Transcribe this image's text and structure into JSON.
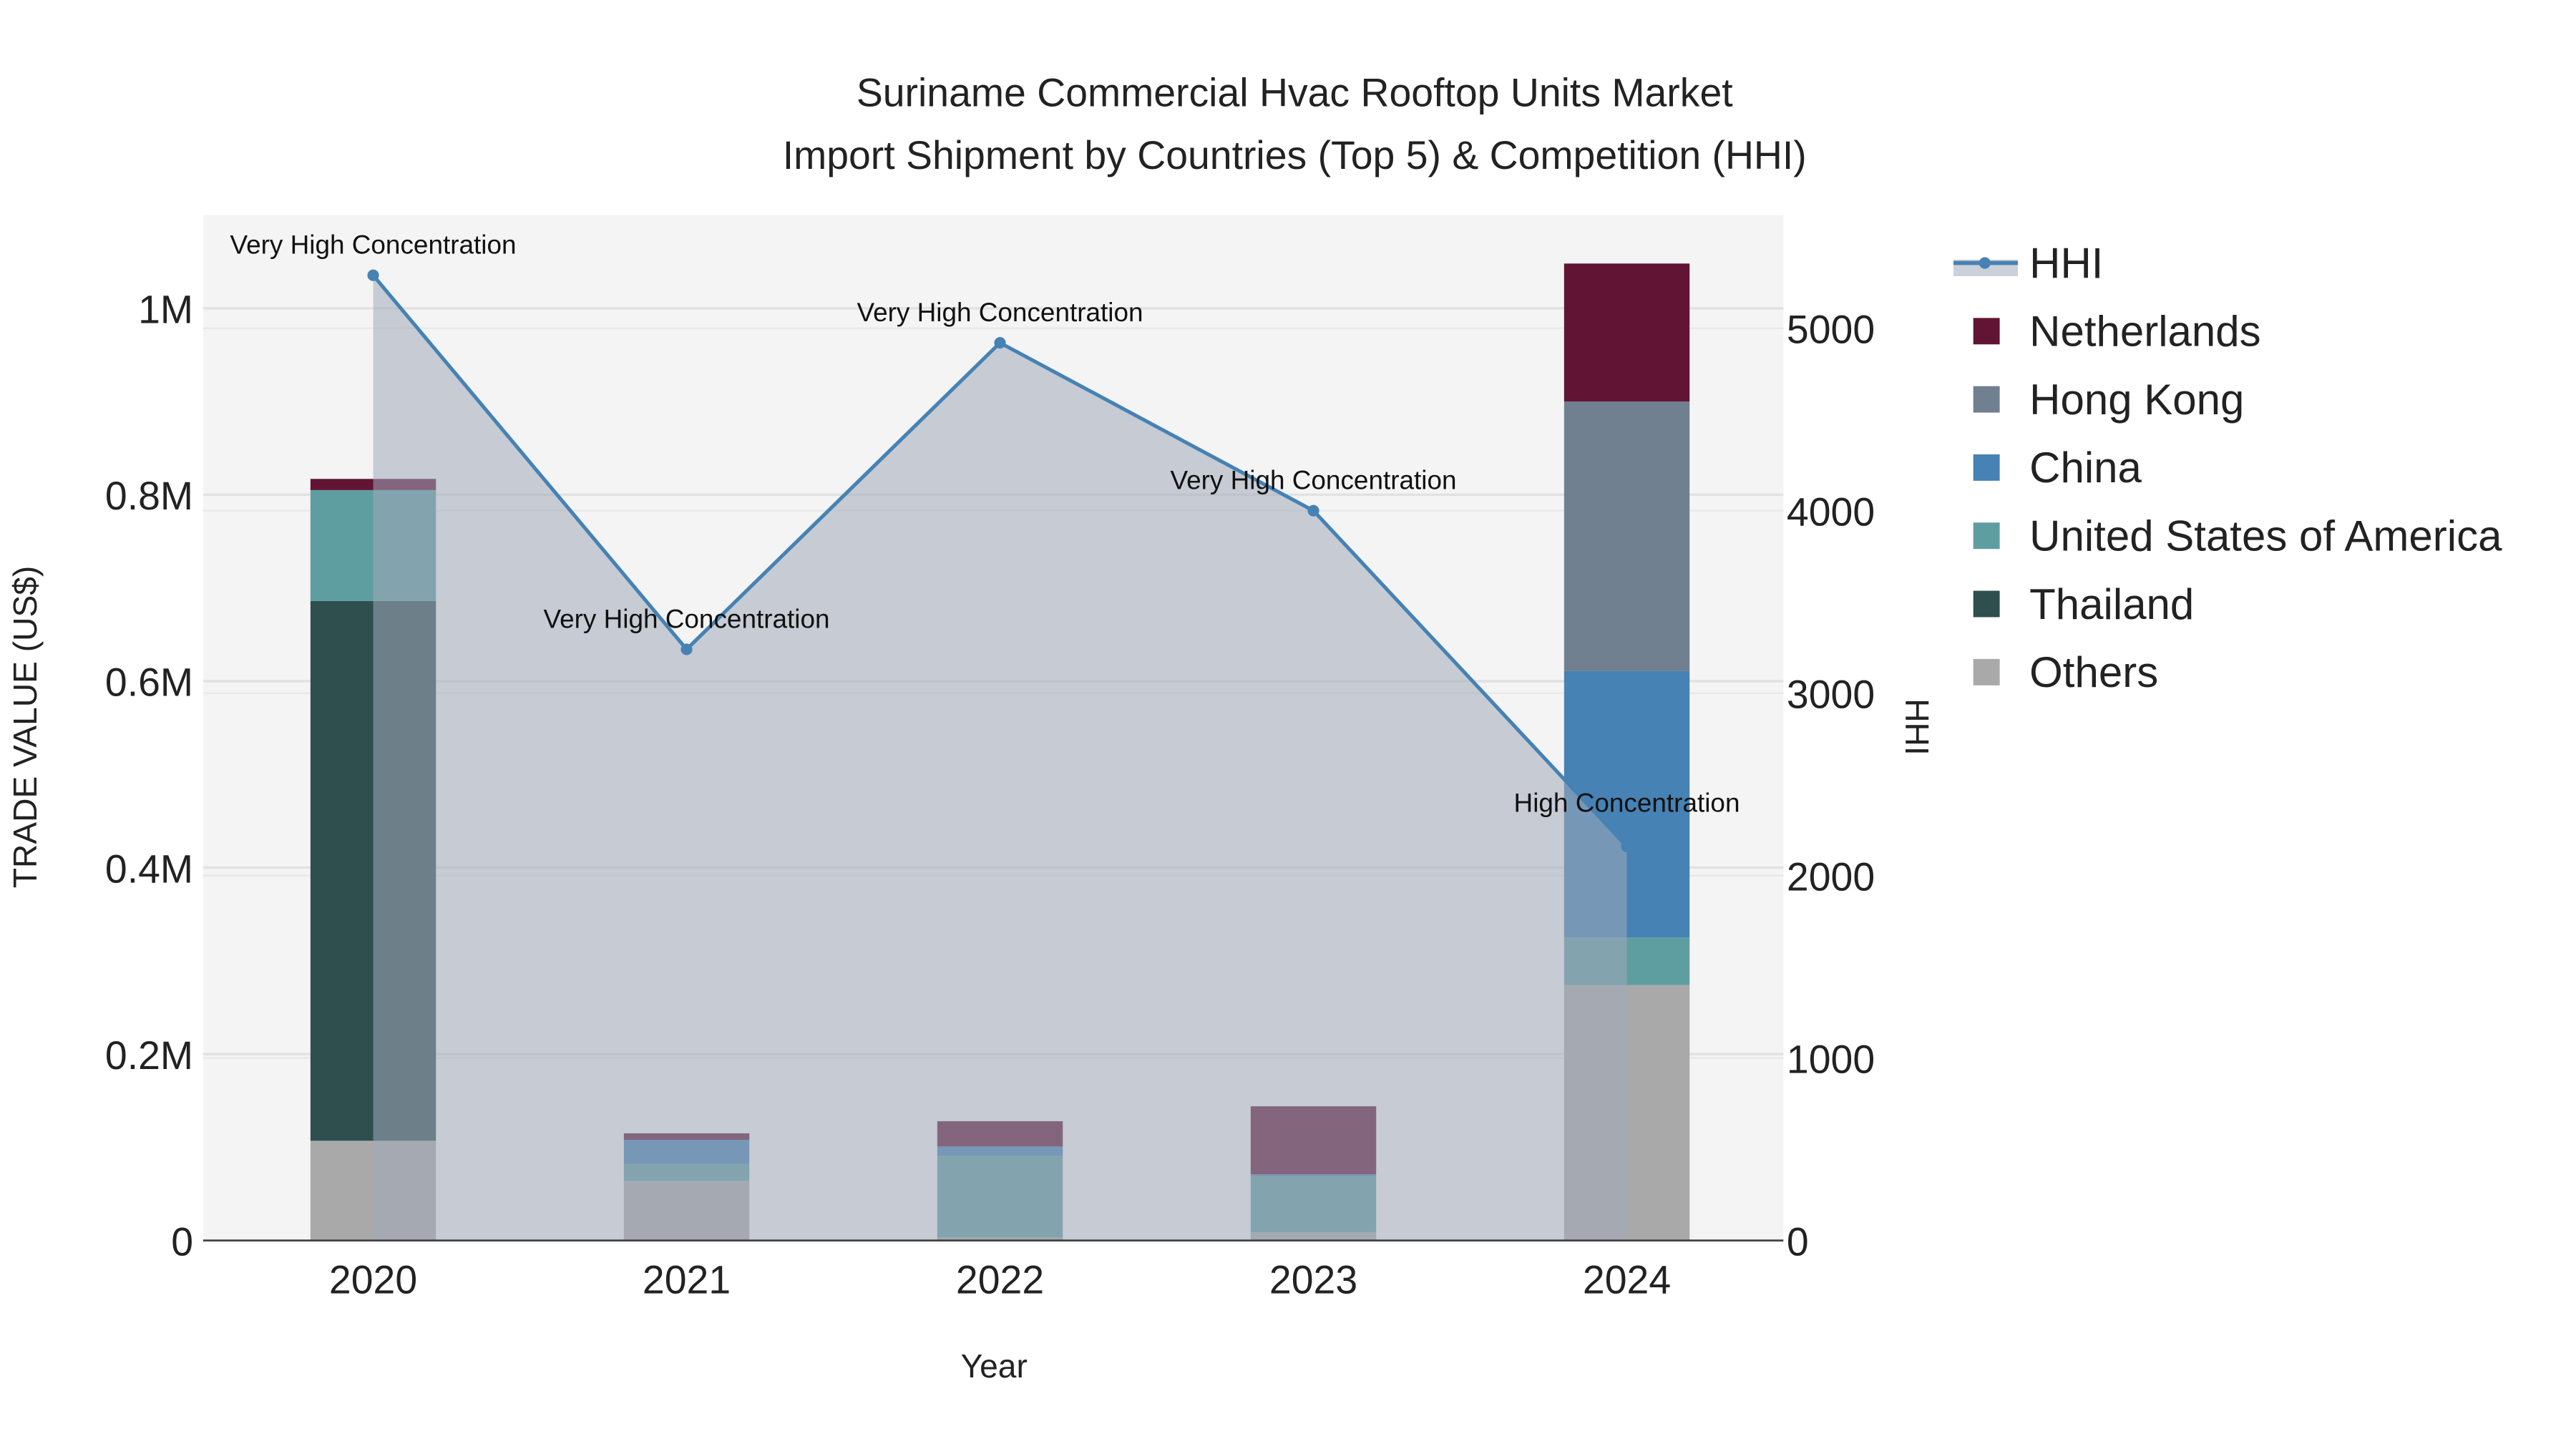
{
  "chart_data": {
    "type": "bar",
    "title": "Suriname Commercial Hvac Rooftop Units Market",
    "subtitle": "Import Shipment by Countries (Top 5) & Competition (HHI)",
    "xlabel": "Year",
    "ylabel": "TRADE VALUE (US$)",
    "y2label": "HHI",
    "categories": [
      "2020",
      "2021",
      "2022",
      "2023",
      "2024"
    ],
    "ylim": [
      0,
      1100000
    ],
    "y2lim": [
      0,
      5620
    ],
    "yticks": [
      {
        "v": 0,
        "label": "0"
      },
      {
        "v": 200000,
        "label": "0.2M"
      },
      {
        "v": 400000,
        "label": "0.4M"
      },
      {
        "v": 600000,
        "label": "0.6M"
      },
      {
        "v": 800000,
        "label": "0.8M"
      },
      {
        "v": 1000000,
        "label": "1M"
      }
    ],
    "y2ticks": [
      {
        "v": 0,
        "label": "0"
      },
      {
        "v": 1000,
        "label": "1000"
      },
      {
        "v": 2000,
        "label": "2000"
      },
      {
        "v": 3000,
        "label": "3000"
      },
      {
        "v": 4000,
        "label": "4000"
      },
      {
        "v": 5000,
        "label": "5000"
      }
    ],
    "grid": true,
    "legend_placement": "right",
    "series": [
      {
        "name": "Others",
        "color": "#a9a9a9",
        "values": [
          107000,
          64000,
          3000,
          9000,
          274000
        ]
      },
      {
        "name": "Thailand",
        "color": "#2f4f4f",
        "values": [
          579000,
          0,
          0,
          0,
          0
        ]
      },
      {
        "name": "United States of America",
        "color": "#5f9ea0",
        "values": [
          119000,
          18000,
          88000,
          60000,
          51000
        ]
      },
      {
        "name": "China",
        "color": "#4682b4",
        "values": [
          0,
          26000,
          10000,
          2000,
          286000
        ]
      },
      {
        "name": "Hong Kong",
        "color": "#708090",
        "values": [
          0,
          0,
          0,
          0,
          289000
        ]
      },
      {
        "name": "Netherlands",
        "color": "#611434",
        "values": [
          12000,
          7000,
          27000,
          73000,
          148000
        ]
      }
    ],
    "hhi": {
      "name": "HHI",
      "color": "#4682b4",
      "values": [
        5290,
        3240,
        4920,
        4000,
        2160
      ],
      "annotations": [
        "Very High Concentration",
        "Very High Concentration",
        "Very High Concentration",
        "Very High Concentration",
        "High Concentration"
      ]
    },
    "legend_order": [
      "HHI",
      "Netherlands",
      "Hong Kong",
      "China",
      "United States of America",
      "Thailand",
      "Others"
    ]
  }
}
